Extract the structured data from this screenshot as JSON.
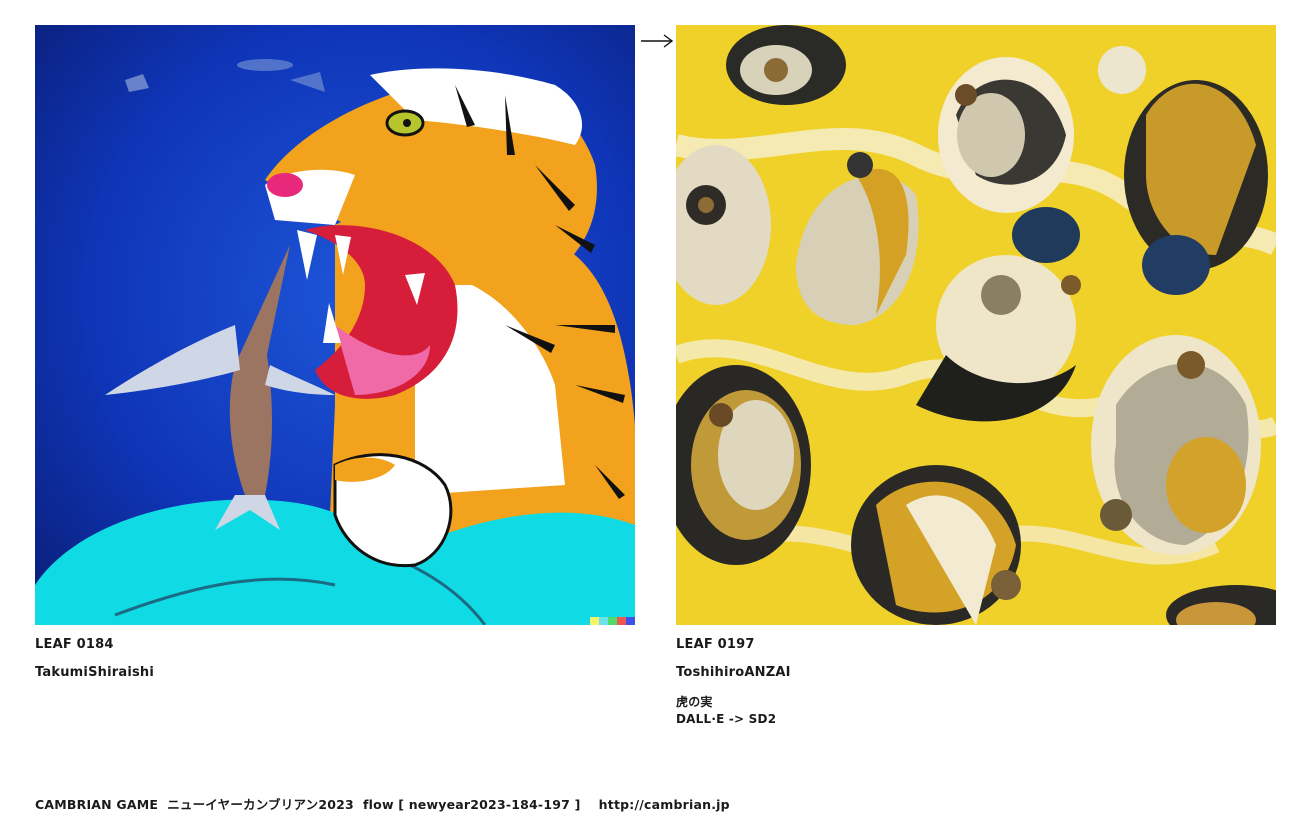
{
  "leaves": [
    {
      "id": "LEAF 0184",
      "author": "TakumiShiraishi",
      "title": "",
      "model": ""
    },
    {
      "id": "LEAF 0197",
      "author": "ToshihiroANZAI",
      "title": "虎の実",
      "model": "DALL·E -> SD2"
    }
  ],
  "arrow_glyph": "⟶",
  "footer": {
    "text": "CAMBRIAN GAME  ニューイヤーカンブリアン2023  flow [ newyear2023-184-197 ]    http://cambrian.jp"
  },
  "colors": {
    "left_bg": "#0d2fb0",
    "tiger_orange": "#f2a21c",
    "cyan_cloth": "#10dbe4",
    "right_bg": "#f0d12a"
  }
}
